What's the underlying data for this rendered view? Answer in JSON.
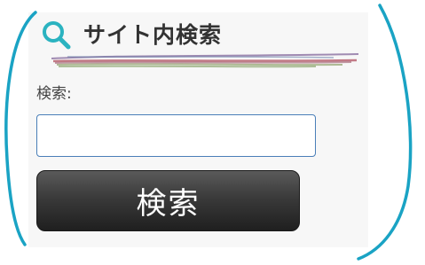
{
  "widget": {
    "title": "サイト内検索",
    "label": "検索:",
    "input_value": "",
    "input_placeholder": "",
    "button_label": "検索"
  },
  "icons": {
    "search": "search-icon"
  },
  "colors": {
    "icon_accent": "#2bb3c0",
    "annotation": "#1aa3c4",
    "button_dark": "#2b2b2b",
    "input_border": "#4a7fb8"
  }
}
